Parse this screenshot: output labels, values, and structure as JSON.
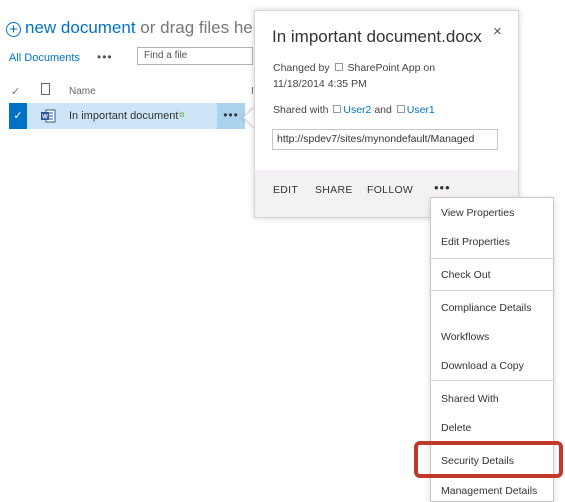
{
  "toolbar": {
    "plus_glyph": "+",
    "new_link": "new document",
    "rest_text": " or drag files her"
  },
  "viewbar": {
    "view_name": "All Documents",
    "ellipsis": "•••",
    "search_placeholder": "Find a file"
  },
  "list_header": {
    "check_glyph": "✓",
    "name_label": "Name",
    "extra_col": "I"
  },
  "row": {
    "check_glyph": "✓",
    "name": "In important document",
    "new_badge": "¤",
    "ellipsis": "•••"
  },
  "callout": {
    "title": "In important document.docx",
    "close_glyph": "×",
    "changed_prefix": "Changed by",
    "changed_by": "SharePoint App on",
    "changed_date": "11/18/2014 4:35 PM",
    "shared_prefix": "Shared with",
    "shared_user1": "User2",
    "shared_and": "and",
    "shared_user2": "User1",
    "url": "http://spdev7/sites/mynondefault/Managed",
    "actions": {
      "edit": "EDIT",
      "share": "SHARE",
      "follow": "FOLLOW",
      "more": "•••"
    }
  },
  "menu": {
    "items": [
      "View Properties",
      "Edit Properties",
      "Check Out",
      "Compliance Details",
      "Workflows",
      "Download a Copy",
      "Shared With",
      "Delete",
      "Security Details",
      "Management Details"
    ],
    "highlighted": "Security Details"
  },
  "colors": {
    "accent": "#0072c6",
    "row_selected": "#cde6f7",
    "highlight": "#c0392b",
    "callout_footer": "#f4f1f4"
  }
}
